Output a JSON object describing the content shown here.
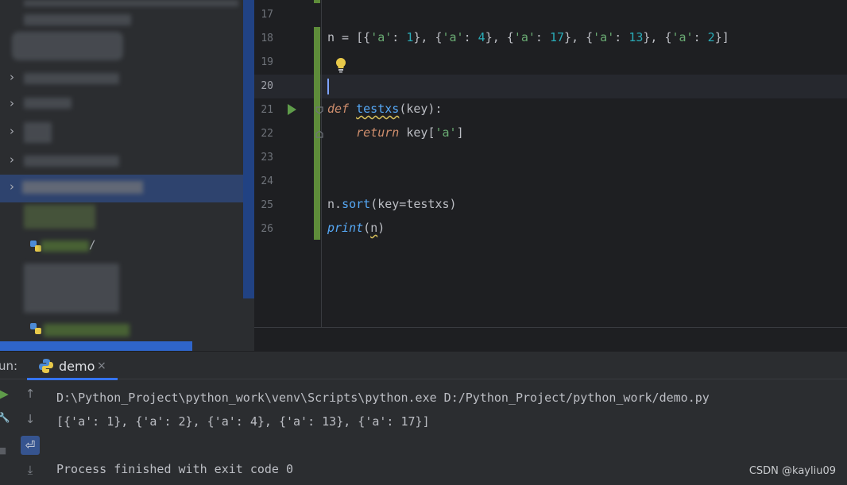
{
  "project_tree": {
    "rows": [
      {
        "label": ""
      },
      {
        "label": ""
      },
      {
        "label": ""
      },
      {
        "label": ""
      },
      {
        "label": ""
      }
    ],
    "file_suffix": "/"
  },
  "editor": {
    "lines": [
      {
        "number": "17",
        "code": ""
      },
      {
        "number": "18",
        "code": "n = [{'a': 1}, {'a': 4}, {'a': 17}, {'a': 13}, {'a': 2}]"
      },
      {
        "number": "19",
        "code": ""
      },
      {
        "number": "20",
        "code": ""
      },
      {
        "number": "21",
        "code": "def testxs(key):"
      },
      {
        "number": "22",
        "code": "    return key['a']"
      },
      {
        "number": "23",
        "code": ""
      },
      {
        "number": "24",
        "code": ""
      },
      {
        "number": "25",
        "code": "n.sort(key=testxs)"
      },
      {
        "number": "26",
        "code": "print(n)"
      }
    ],
    "tokens": {
      "n": "n",
      "eq": " = ",
      "lb": "[",
      "rb": "]",
      "comma": ", ",
      "ob": "{",
      "cb": "}",
      "key_a": "'a'",
      "colon": ": ",
      "v1": "1",
      "v4": "4",
      "v17": "17",
      "v13": "13",
      "v2": "2",
      "def": "def",
      "testxs": "testxs",
      "params": "(key):",
      "return": "return",
      "key": " key",
      "idx_open": "[",
      "idx_close": "]",
      "nsort": "n.",
      "sort": "sort",
      "sort_args": "(key=testxs)",
      "print": "print",
      "print_open": "(",
      "print_arg": "n",
      "print_close": ")",
      "indent": "    "
    }
  },
  "run_panel": {
    "title": "un:",
    "tab_label": "demo",
    "tab_close": "×",
    "console_lines": [
      "D:\\Python_Project\\python_work\\venv\\Scripts\\python.exe D:/Python_Project/python_work/demo.py",
      "[{'a': 1}, {'a': 2}, {'a': 4}, {'a': 13}, {'a': 17}]",
      "",
      "Process finished with exit code 0"
    ],
    "tools": {
      "rerun": "▶",
      "up": "↑",
      "down": "↓",
      "wrench": "🔧",
      "stop": "■",
      "wrap": "⏎",
      "scroll_end": "⤓"
    }
  },
  "watermark": "CSDN @kayliu09",
  "colors": {
    "accent": "#3574f0",
    "change_bar": "#5e8c3a",
    "string": "#6aab73",
    "number": "#2aacb8",
    "keyword": "#cf8e6d",
    "function": "#56a8f5"
  }
}
